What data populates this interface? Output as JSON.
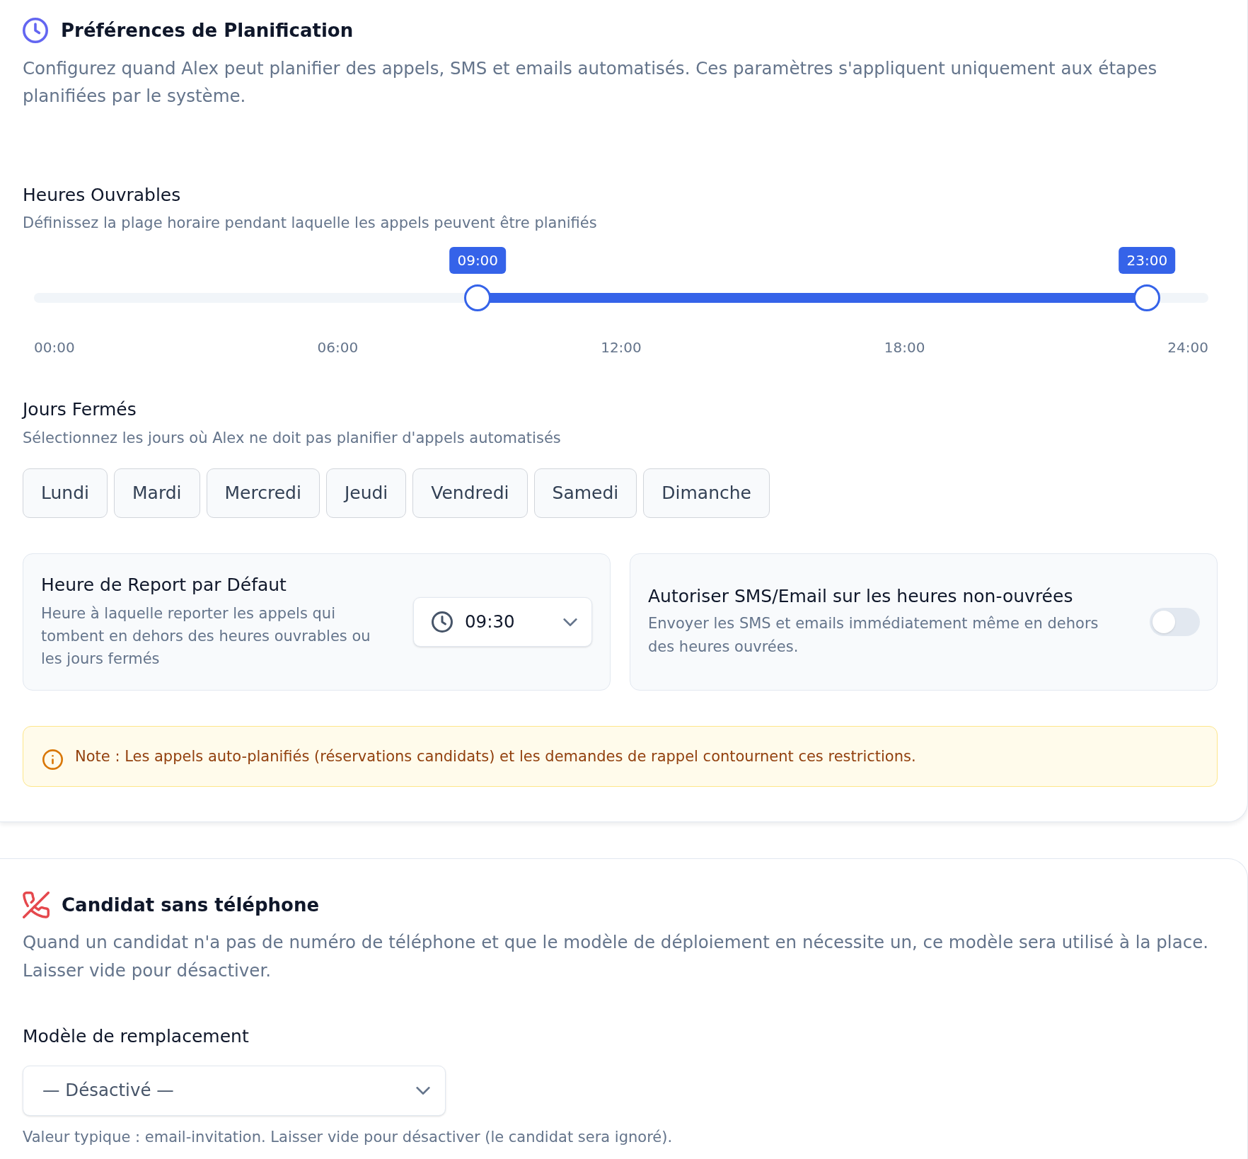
{
  "scheduling": {
    "title": "Préférences de Planification",
    "description": "Configurez quand Alex peut planifier des appels, SMS et emails automatisés. Ces paramètres s'appliquent uniquement aux étapes planifiées par le système."
  },
  "business_hours": {
    "label": "Heures Ouvrables",
    "description": "Définissez la plage horaire pendant laquelle les appels peuvent être planifiés",
    "thumbs": [
      {
        "value_label": "09:00",
        "level": 0.375
      },
      {
        "value_label": "23:00",
        "level": 0.9583
      }
    ],
    "ticks": [
      "00:00",
      "06:00",
      "12:00",
      "18:00",
      "24:00"
    ]
  },
  "closed_days": {
    "label": "Jours Fermés",
    "description": "Sélectionnez les jours où Alex ne doit pas planifier d'appels automatisés",
    "days": [
      {
        "label": "Lundi",
        "selected": false
      },
      {
        "label": "Mardi",
        "selected": false
      },
      {
        "label": "Mercredi",
        "selected": false
      },
      {
        "label": "Jeudi",
        "selected": false
      },
      {
        "label": "Vendredi",
        "selected": false
      },
      {
        "label": "Samedi",
        "selected": false
      },
      {
        "label": "Dimanche",
        "selected": false
      }
    ]
  },
  "default_time": {
    "title": "Heure de Report par Défaut",
    "description": "Heure à laquelle reporter les appels qui tombent en dehors des heures ouvrables ou les jours fermés",
    "value": "09:30"
  },
  "off_hours_messaging": {
    "title": "Autoriser SMS/Email sur les heures non-ouvrées",
    "description": "Envoyer les SMS et emails immédiatement même en dehors des heures ouvrées.",
    "on": false
  },
  "note": {
    "text": "Note : Les appels auto-planifiés (réservations candidats) et les demandes de rappel contournent ces restrictions."
  },
  "no_phone": {
    "title": "Candidat sans téléphone",
    "description": "Quand un candidat n'a pas de numéro de téléphone et que le modèle de déploiement en nécessite un, ce modèle sera utilisé à la place. Laisser vide pour désactiver.",
    "field_label": "Modèle de remplacement",
    "selected_option": "— Désactivé —",
    "hint": "Valeur typique : email-invitation. Laisser vide pour désactiver (le candidat sera ignoré)."
  }
}
